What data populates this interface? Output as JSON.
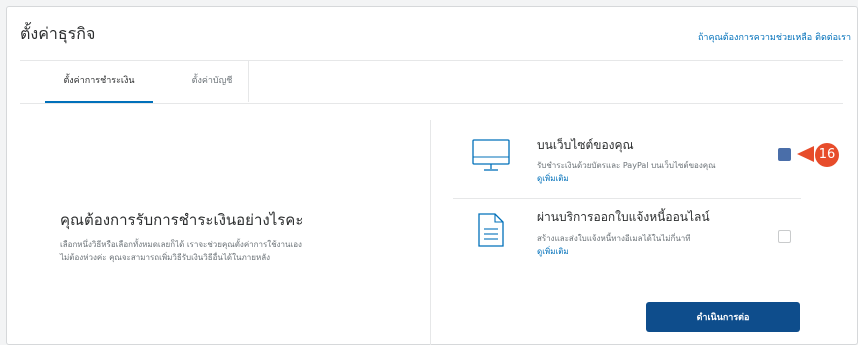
{
  "header": {
    "title": "ตั้งค่าธุรกิจ",
    "help_text": "ถ้าคุณต้องการความช่วยเหลือ",
    "help_link": "ติดต่อเรา"
  },
  "tabs": [
    {
      "label": "ตั้งค่าการชำระเงิน",
      "active": true
    },
    {
      "label": "ตั้งค่าบัญชี",
      "active": false
    }
  ],
  "left": {
    "question": "คุณต้องการรับการชำระเงินอย่างไรคะ",
    "explain_line1": "เลือกหนึ่งวิธีหรือเลือกทั้งหมดเลยก็ได้ เราจะช่วยคุณตั้งค่าการใช้งานเอง",
    "explain_line2": "ไม่ต้องห่วงค่ะ คุณจะสามารถเพิ่มวิธีรับเงินวิธีอื่นได้ในภายหลัง"
  },
  "options": [
    {
      "title": "บนเว็บไซต์ของคุณ",
      "description": "รับชำระเงินด้วยบัตรและ PayPal บนเว็บไซต์ของคุณ",
      "more": "ดูเพิ่มเติม",
      "icon": "monitor-icon",
      "checked": true
    },
    {
      "title": "ผ่านบริการออกใบแจ้งหนี้ออนไลน์",
      "description": "สร้างและส่งใบแจ้งหนี้ทางอีเมลได้ในไม่กี่นาที",
      "more": "ดูเพิ่มเติม",
      "icon": "document-icon",
      "checked": false
    }
  ],
  "annotation": {
    "step": "16",
    "color": "#e74c2b"
  },
  "continue_label": "ดำเนินการต่อ",
  "colors": {
    "accent": "#0070ba",
    "button": "#0e4d8c",
    "checked": "#4a6ea9"
  }
}
